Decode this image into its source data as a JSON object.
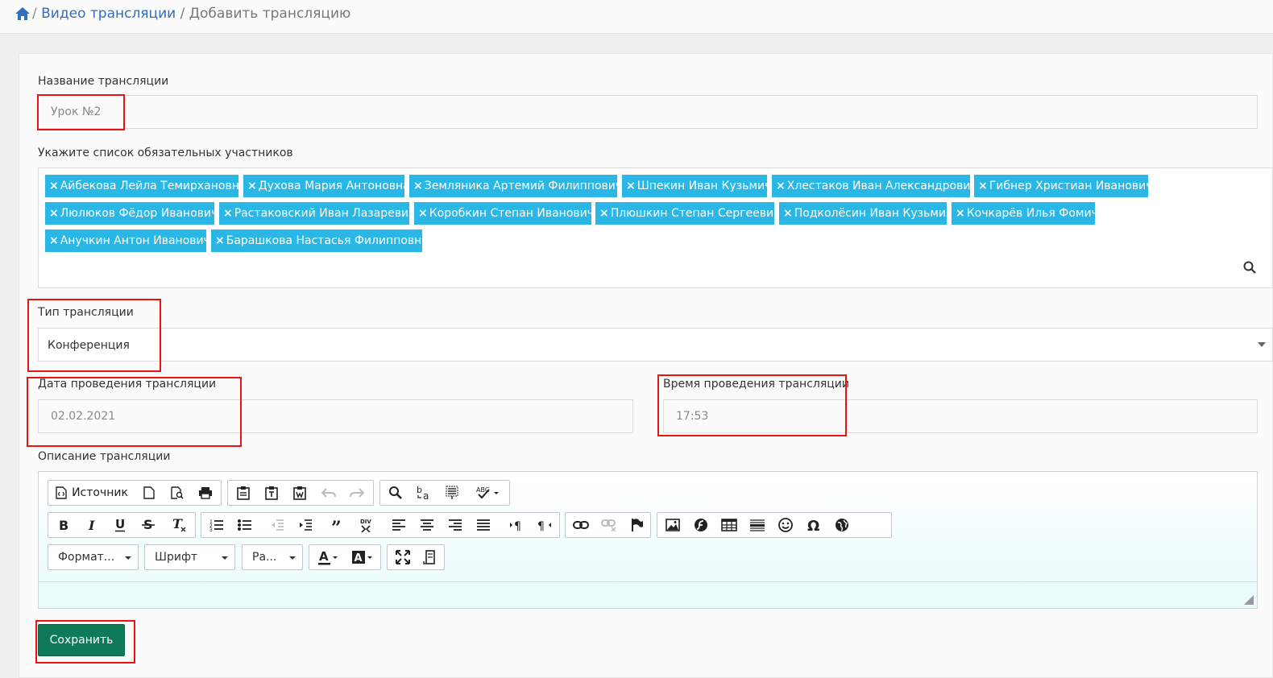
{
  "breadcrumb": {
    "sep1": "/",
    "link": "Видео трансляции",
    "sep2": "/",
    "current": "Добавить трансляцию"
  },
  "form": {
    "name_label": "Название трансляции",
    "name_value": "Урок №2",
    "participants_label": "Укажите список обязательных участников",
    "participants": [
      "Айбекова Лейла Темирхановна",
      "Духова Мария Антоновна",
      "Земляника Артемий Филиппович",
      "Шпекин Иван Кузьмич",
      "Хлестаков Иван Александрович",
      "Гибнер Христиан Иванович",
      "Люлюков Фёдор Иванович",
      "Растаковский Иван Лазаревич",
      "Коробкин Степан Иванович",
      "Плюшкин Степан Сергеевич",
      "Подколёсин Иван Кузьмич",
      "Кочкарёв Илья Фомич",
      "Анучкин Антон Иванович",
      "Барашкова Настасья Филипповна"
    ],
    "tag_remove": "×",
    "type_label": "Тип трансляции",
    "type_value": "Конференция",
    "date_label": "Дата проведения трансляции",
    "date_value": "02.02.2021",
    "time_label": "Время проведения трансляции",
    "time_value": "17:53",
    "description_label": "Описание трансляции",
    "save_label": "Сохранить"
  },
  "editor": {
    "source_label": "Источник",
    "format_label": "Формат...",
    "font_label": "Шрифт",
    "size_label": "Ра...",
    "icons": [
      "source-icon",
      "new-page-icon",
      "preview-icon",
      "print-icon",
      "paste-icon",
      "paste-text-icon",
      "paste-word-icon",
      "undo-icon",
      "redo-icon",
      "find-icon",
      "replace-icon",
      "select-all-icon",
      "spellcheck-icon",
      "bold-icon",
      "italic-icon",
      "underline-icon",
      "strike-icon",
      "remove-format-icon",
      "numbered-list-icon",
      "bulleted-list-icon",
      "outdent-icon",
      "indent-icon",
      "blockquote-icon",
      "div-icon",
      "align-left-icon",
      "align-center-icon",
      "align-right-icon",
      "justify-icon",
      "ltr-icon",
      "rtl-icon",
      "link-icon",
      "unlink-icon",
      "anchor-icon",
      "image-icon",
      "flash-icon",
      "table-icon",
      "hr-icon",
      "smiley-icon",
      "special-char-icon",
      "iframe-icon",
      "text-color-icon",
      "bg-color-icon",
      "maximize-icon",
      "show-blocks-icon"
    ]
  },
  "colors": {
    "tag_bg": "#2bb7e6",
    "save_bg": "#0f7a5a",
    "link": "#2f6fbd",
    "highlight": "#e8140f"
  }
}
